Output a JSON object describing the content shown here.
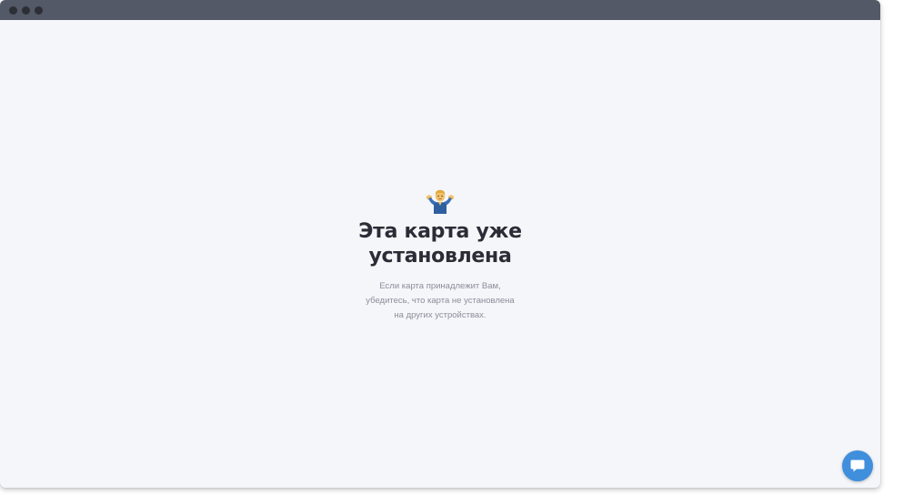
{
  "window": {
    "titlebar_color": "#535966"
  },
  "message": {
    "emoji_icon": "person-shrugging-icon",
    "title_line1": "Эта карта уже",
    "title_line2": "установлена",
    "subtitle_line1": "Если карта принадлежит Вам,",
    "subtitle_line2": "убедитесь, что карта не установлена",
    "subtitle_line3": "на других устройствах."
  },
  "chat": {
    "icon": "chat-bubble-icon",
    "color": "#3f8fdd"
  }
}
